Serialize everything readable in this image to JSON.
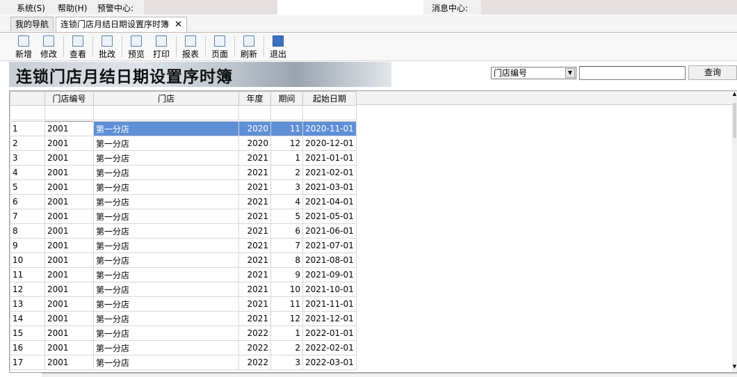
{
  "menu": {
    "system": "系统(S)",
    "help": "帮助(H)",
    "alert_center": "预警中心:",
    "message_center": "消息中心:"
  },
  "tabs": [
    {
      "label": "我的导航"
    },
    {
      "label": "连锁门店月结日期设置序时簿",
      "close": "✕"
    }
  ],
  "toolbar": {
    "new": "新增",
    "edit": "修改",
    "view": "查看",
    "batch_edit": "批改",
    "preview": "预览",
    "print": "打印",
    "report": "报表",
    "page": "页面",
    "refresh": "刷新",
    "exit": "退出"
  },
  "page_title": "连锁门店月结日期设置序时簿",
  "search": {
    "field": "门店编号",
    "value": "",
    "button": "查询"
  },
  "grid": {
    "columns": [
      "门店编号",
      "门店",
      "年度",
      "期间",
      "起始日期"
    ],
    "rows": [
      {
        "n": "1",
        "code": "2001",
        "store": "第一分店",
        "year": "2020",
        "period": "11",
        "start": "2020-11-01"
      },
      {
        "n": "2",
        "code": "2001",
        "store": "第一分店",
        "year": "2020",
        "period": "12",
        "start": "2020-12-01"
      },
      {
        "n": "3",
        "code": "2001",
        "store": "第一分店",
        "year": "2021",
        "period": "1",
        "start": "2021-01-01"
      },
      {
        "n": "4",
        "code": "2001",
        "store": "第一分店",
        "year": "2021",
        "period": "2",
        "start": "2021-02-01"
      },
      {
        "n": "5",
        "code": "2001",
        "store": "第一分店",
        "year": "2021",
        "period": "3",
        "start": "2021-03-01"
      },
      {
        "n": "6",
        "code": "2001",
        "store": "第一分店",
        "year": "2021",
        "period": "4",
        "start": "2021-04-01"
      },
      {
        "n": "7",
        "code": "2001",
        "store": "第一分店",
        "year": "2021",
        "period": "5",
        "start": "2021-05-01"
      },
      {
        "n": "8",
        "code": "2001",
        "store": "第一分店",
        "year": "2021",
        "period": "6",
        "start": "2021-06-01"
      },
      {
        "n": "9",
        "code": "2001",
        "store": "第一分店",
        "year": "2021",
        "period": "7",
        "start": "2021-07-01"
      },
      {
        "n": "10",
        "code": "2001",
        "store": "第一分店",
        "year": "2021",
        "period": "8",
        "start": "2021-08-01"
      },
      {
        "n": "11",
        "code": "2001",
        "store": "第一分店",
        "year": "2021",
        "period": "9",
        "start": "2021-09-01"
      },
      {
        "n": "12",
        "code": "2001",
        "store": "第一分店",
        "year": "2021",
        "period": "10",
        "start": "2021-10-01"
      },
      {
        "n": "13",
        "code": "2001",
        "store": "第一分店",
        "year": "2021",
        "period": "11",
        "start": "2021-11-01"
      },
      {
        "n": "14",
        "code": "2001",
        "store": "第一分店",
        "year": "2021",
        "period": "12",
        "start": "2021-12-01"
      },
      {
        "n": "15",
        "code": "2001",
        "store": "第一分店",
        "year": "2022",
        "period": "1",
        "start": "2022-01-01"
      },
      {
        "n": "16",
        "code": "2001",
        "store": "第一分店",
        "year": "2022",
        "period": "2",
        "start": "2022-02-01"
      },
      {
        "n": "17",
        "code": "2001",
        "store": "第一分店",
        "year": "2022",
        "period": "3",
        "start": "2022-03-01"
      }
    ],
    "selected_row": 1
  },
  "colors": {
    "selection": "#5f8fd6",
    "menu_highlight": "#e6dfdf"
  }
}
